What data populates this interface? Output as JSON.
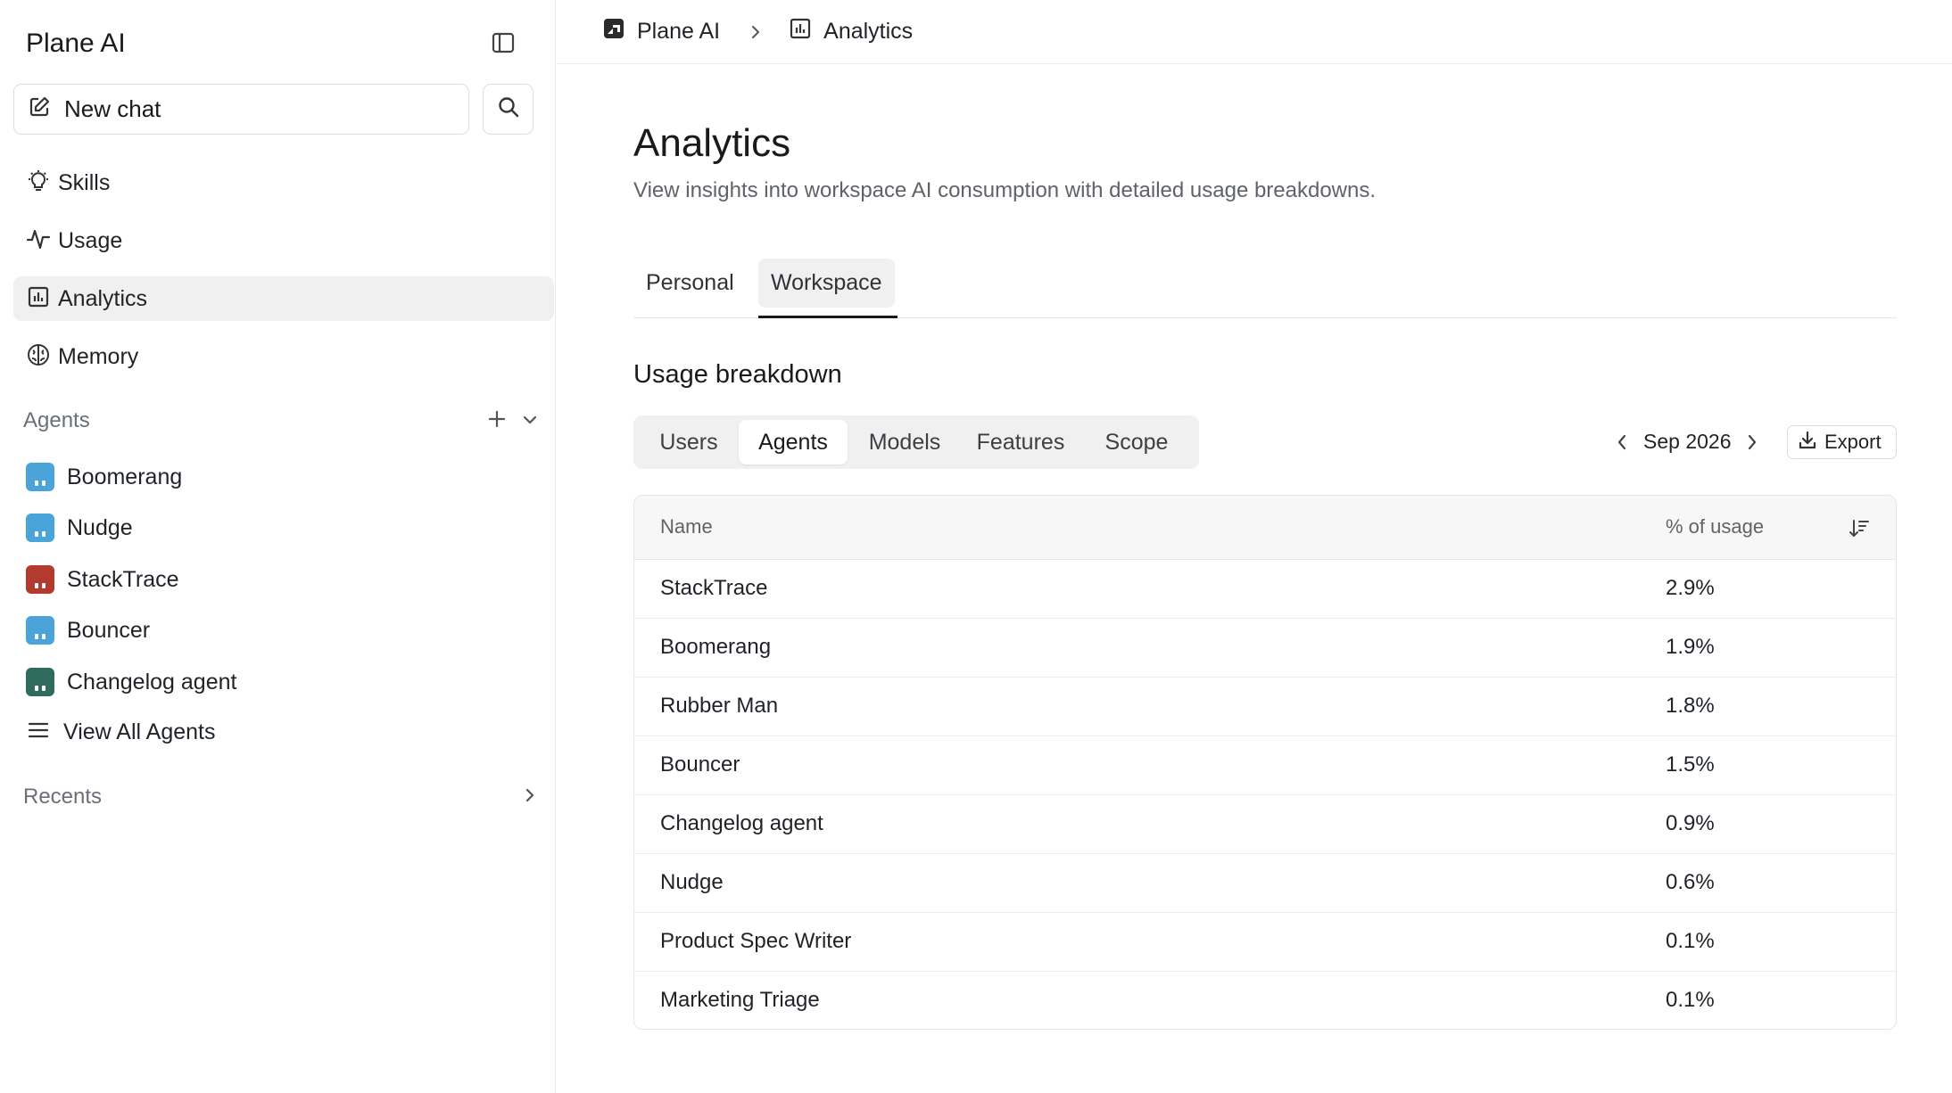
{
  "sidebar": {
    "app_title": "Plane AI",
    "new_chat_label": "New chat",
    "nav": [
      {
        "label": "Skills",
        "icon": "lightbulb-icon"
      },
      {
        "label": "Usage",
        "icon": "activity-icon"
      },
      {
        "label": "Analytics",
        "icon": "bar-chart-icon",
        "active": true
      },
      {
        "label": "Memory",
        "icon": "brain-icon"
      }
    ],
    "agents_heading": "Agents",
    "agents": [
      {
        "label": "Boomerang",
        "color": "#4aa3d9"
      },
      {
        "label": "Nudge",
        "color": "#4aa3d9"
      },
      {
        "label": "StackTrace",
        "color": "#b23a2e"
      },
      {
        "label": "Bouncer",
        "color": "#4aa3d9"
      },
      {
        "label": "Changelog agent",
        "color": "#2f6b5f"
      }
    ],
    "view_all_label": "View All Agents",
    "recents_heading": "Recents"
  },
  "breadcrumb": {
    "items": [
      "Plane AI",
      "Analytics"
    ]
  },
  "page": {
    "title": "Analytics",
    "subtitle": "View insights into workspace AI consumption with detailed usage breakdowns.",
    "tabs": [
      "Personal",
      "Workspace"
    ],
    "active_tab": "Workspace",
    "section_title": "Usage breakdown",
    "segments": [
      "Users",
      "Agents",
      "Models",
      "Features",
      "Scope"
    ],
    "active_segment": "Agents",
    "month": "Sep 2026",
    "export_label": "Export"
  },
  "table": {
    "columns": [
      "Name",
      "% of usage"
    ],
    "rows": [
      {
        "name": "StackTrace",
        "usage": "2.9%"
      },
      {
        "name": "Boomerang",
        "usage": "1.9%"
      },
      {
        "name": "Rubber Man",
        "usage": "1.8%"
      },
      {
        "name": "Bouncer",
        "usage": "1.5%"
      },
      {
        "name": "Changelog agent",
        "usage": "0.9%"
      },
      {
        "name": "Nudge",
        "usage": "0.6%"
      },
      {
        "name": "Product Spec Writer",
        "usage": "0.1%"
      },
      {
        "name": "Marketing Triage",
        "usage": "0.1%"
      }
    ]
  }
}
